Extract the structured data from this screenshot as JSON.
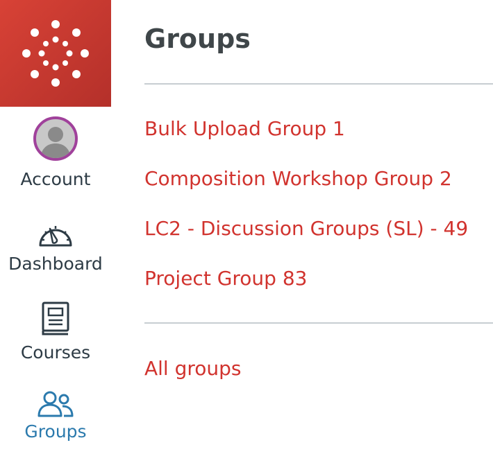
{
  "nav": {
    "account_label": "Account",
    "dashboard_label": "Dashboard",
    "courses_label": "Courses",
    "groups_label": "Groups",
    "brand_color": "#d84236",
    "active_color": "#2b7aad",
    "avatar_ring_color": "#a0419b"
  },
  "tray": {
    "title": "Groups",
    "groups": [
      "Bulk Upload Group 1",
      "Composition Workshop Group 2",
      "LC2 - Discussion Groups (SL) - 49",
      "Project Group 83"
    ],
    "all_groups_label": "All groups",
    "link_color": "#d1332e"
  }
}
